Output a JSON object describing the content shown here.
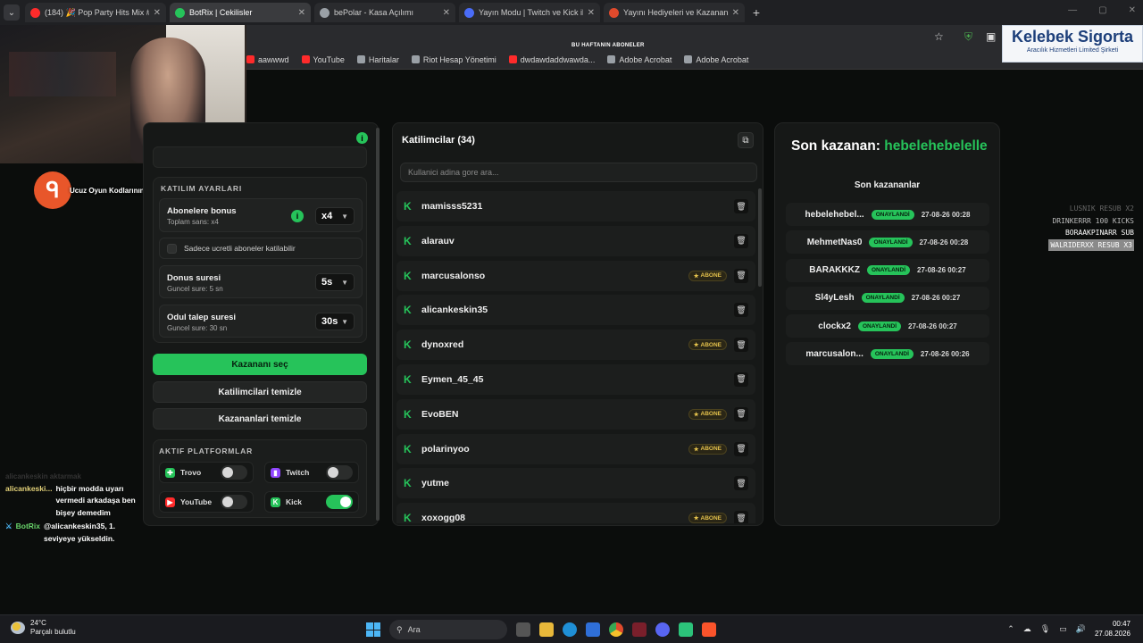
{
  "browser": {
    "tabs": [
      {
        "title": "(184) 🎉 Pop Party Hits Mix #0...",
        "color": "#ff2b2b",
        "active": false
      },
      {
        "title": "BotRix | Cekilisler",
        "color": "#26c35a",
        "active": true
      },
      {
        "title": "bePolar - Kasa Açılımı",
        "color": "#9aa0a6",
        "active": false
      },
      {
        "title": "Yayın Modu | Twitch ve Kick ile",
        "color": "#4a6cf7",
        "active": false
      },
      {
        "title": "Yayını Hediyeleri ve Kazananla",
        "color": "#e04a2c",
        "active": false
      }
    ],
    "bookmarks": [
      {
        "label": "aawwwd",
        "color": "#ff2b2b"
      },
      {
        "label": "YouTube",
        "color": "#ff2b2b"
      },
      {
        "label": "Haritalar",
        "color": "#9aa0a6"
      },
      {
        "label": "Riot Hesap Yönetimi",
        "color": "#9aa0a6"
      },
      {
        "label": "dwdawdaddwawda...",
        "color": "#ff2b2b"
      },
      {
        "label": "Adobe Acrobat",
        "color": "#9aa0a6"
      },
      {
        "label": "Adobe Acrobat",
        "color": "#9aa0a6"
      }
    ]
  },
  "overlay": {
    "subs_title": "BU HAFTANIN ABONELER",
    "brand_name": "Kelebek Sigorta",
    "brand_tagline": "Aracılık Hizmetleri Limited Şirketi",
    "promo_text": "Ucuz Oyun Kodlarının Adresi",
    "events": [
      "LUSNIK RESUB X2",
      "DRINKERRR 100 KICKS",
      "BORAAKPINARR SUB",
      "WALRIDERXX RESUB X3"
    ]
  },
  "settings": {
    "section_title": "KATILIM AYARLARI",
    "subscriber_bonus_label": "Abonelere bonus",
    "subscriber_bonus_sub": "Toplam sans: x4",
    "subscriber_bonus_value": "x4",
    "only_paid_label": "Sadece ucretli aboneler katilabilir",
    "bonus_time_label": "Donus suresi",
    "bonus_time_sub": "Guncel sure: 5 sn",
    "bonus_time_value": "5s",
    "claim_time_label": "Odul talep suresi",
    "claim_time_sub": "Guncel sure: 30 sn",
    "claim_time_value": "30s"
  },
  "actions": {
    "pick_winner": "Kazananı seç",
    "clear_participants": "Katilimcilari temizle",
    "clear_winners": "Kazananlari temizle"
  },
  "platforms": {
    "title": "AKTIF PLATFORMLAR",
    "items": [
      {
        "name": "Trovo",
        "enabled": false,
        "color": "#26c35a"
      },
      {
        "name": "Twitch",
        "enabled": false,
        "color": "#9146ff"
      },
      {
        "name": "YouTube",
        "enabled": false,
        "color": "#ff2b2b"
      },
      {
        "name": "Kick",
        "enabled": true,
        "color": "#26c35a"
      }
    ]
  },
  "participants": {
    "title": "Katilimcilar (34)",
    "search_placeholder": "Kullanici adina gore ara...",
    "abone_label": "ABONE",
    "list": [
      {
        "name": "mamisss5231",
        "abone": false
      },
      {
        "name": "alarauv",
        "abone": false
      },
      {
        "name": "marcusalonso",
        "abone": true
      },
      {
        "name": "alicankeskin35",
        "abone": false
      },
      {
        "name": "dynoxred",
        "abone": true
      },
      {
        "name": "Eymen_45_45",
        "abone": false
      },
      {
        "name": "EvoBEN",
        "abone": true
      },
      {
        "name": "polarinyoo",
        "abone": true
      },
      {
        "name": "yutme",
        "abone": false
      },
      {
        "name": "xoxogg08",
        "abone": true
      }
    ]
  },
  "winners": {
    "last_winner_label": "Son kazanan:",
    "last_winner_name": "hebelehebelelle",
    "list_title": "Son kazananlar",
    "badge_label": "ONAYLANDİ",
    "list": [
      {
        "name": "hebelehebel...",
        "time": "27-08-26 00:28"
      },
      {
        "name": "MehmetNas0",
        "time": "27-08-26 00:28"
      },
      {
        "name": "BARAKKKZ",
        "time": "27-08-26 00:27"
      },
      {
        "name": "Sl4yLesh",
        "time": "27-08-26 00:27"
      },
      {
        "name": "clockx2",
        "time": "27-08-26 00:27"
      },
      {
        "name": "marcusalon...",
        "time": "27-08-26 00:26"
      }
    ]
  },
  "chat": {
    "faded_line": "alicankeskin aktarmak",
    "messages": [
      {
        "user": "alicankeski...",
        "text": "hiçbir modda uyarı vermedi arkadaşa ben bişey demedim"
      },
      {
        "user": "BotRix",
        "text": "@alicankeskin35, 1. seviyeye yükseldin."
      }
    ]
  },
  "taskbar": {
    "temperature": "24°C",
    "weather": "Parçalı bulutlu",
    "search_label": "Ara",
    "time": "00:47",
    "date": "27.08.2026"
  }
}
